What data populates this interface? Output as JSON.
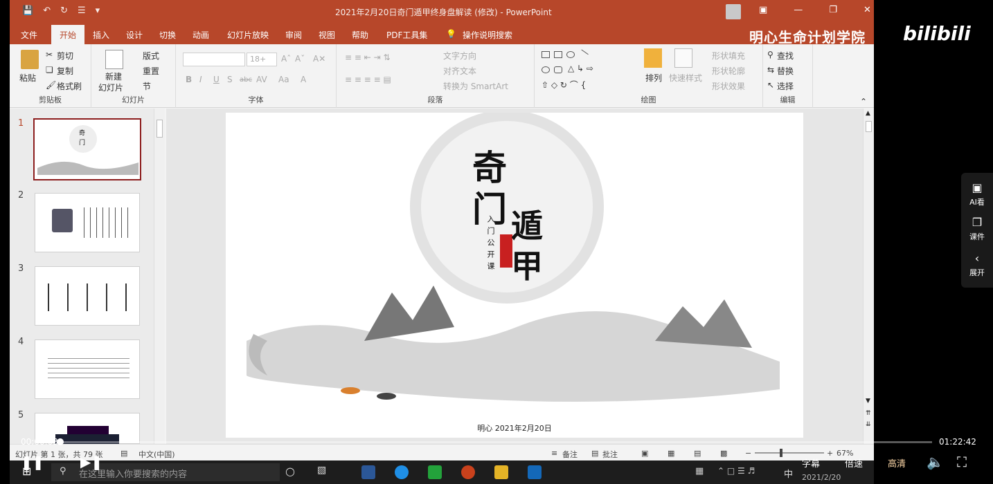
{
  "window": {
    "title": "2021年2月20日奇门遁甲终身盘解读 (修改) - PowerPoint",
    "qat_icons": [
      "save-icon",
      "undo-icon",
      "redo-icon",
      "customize-icon"
    ]
  },
  "tabs": [
    "文件",
    "开始",
    "插入",
    "设计",
    "切换",
    "动画",
    "幻灯片放映",
    "审阅",
    "视图",
    "帮助",
    "PDF工具集",
    "操作说明搜索"
  ],
  "active_tab_index": 1,
  "brand": {
    "channel": "明心生命计划学院",
    "site": "bilibili"
  },
  "ribbon": {
    "clipboard": {
      "paste": "粘贴",
      "cut": "剪切",
      "copy": "复制",
      "format_painter": "格式刷",
      "label": "剪贴板"
    },
    "slides": {
      "new_slide": "新建",
      "new_slide_line2": "幻灯片",
      "layout": "版式",
      "reset": "重置",
      "section": "节",
      "label": "幻灯片"
    },
    "font": {
      "size_value": "18+",
      "label": "字体",
      "buttons": [
        "B",
        "I",
        "U",
        "S",
        "abc",
        "AV",
        "Aa",
        "A"
      ]
    },
    "paragraph": {
      "text_direction": "文字方向",
      "align_text": "对齐文本",
      "convert_smartart": "转换为 SmartArt",
      "label": "段落"
    },
    "drawing": {
      "arrange": "排列",
      "quick_styles": "快速样式",
      "shape_fill": "形状填充",
      "shape_outline": "形状轮廓",
      "shape_effects": "形状效果",
      "label": "绘图"
    },
    "editing": {
      "find": "查找",
      "replace": "替换",
      "select": "选择",
      "label": "编辑"
    }
  },
  "thumbnails": [
    {
      "number": "1",
      "selected": true
    },
    {
      "number": "2",
      "selected": false
    },
    {
      "number": "3",
      "selected": false
    },
    {
      "number": "4",
      "selected": false
    },
    {
      "number": "5",
      "selected": false
    }
  ],
  "slide": {
    "title_chars": [
      "奇",
      "门",
      "遁",
      "甲"
    ],
    "subtitle_vertical": "入门公开课",
    "footer": "明心 2021年2月20日"
  },
  "statusbar": {
    "slide_counter": "幻灯片 第 1 张，共 79 张",
    "language": "中文(中国)",
    "notes": "备注",
    "comments": "批注",
    "zoom": "67%"
  },
  "taskbar": {
    "search_placeholder": "在这里输入你要搜索的内容",
    "ime": "中",
    "date": "2021/2/20"
  },
  "player": {
    "current_time": "00:00:03",
    "total_time": "01:22:42",
    "progress_fraction": 0.0006,
    "subtitle": "字幕",
    "speed": "倍速",
    "quality": "高清",
    "accent": "#00aeec"
  },
  "side_panel": {
    "ai": "AI看",
    "courseware": "课件",
    "expand": "展开"
  },
  "colors": {
    "ppt_accent": "#b7472a",
    "selected_thumb": "#8c1d1d"
  }
}
